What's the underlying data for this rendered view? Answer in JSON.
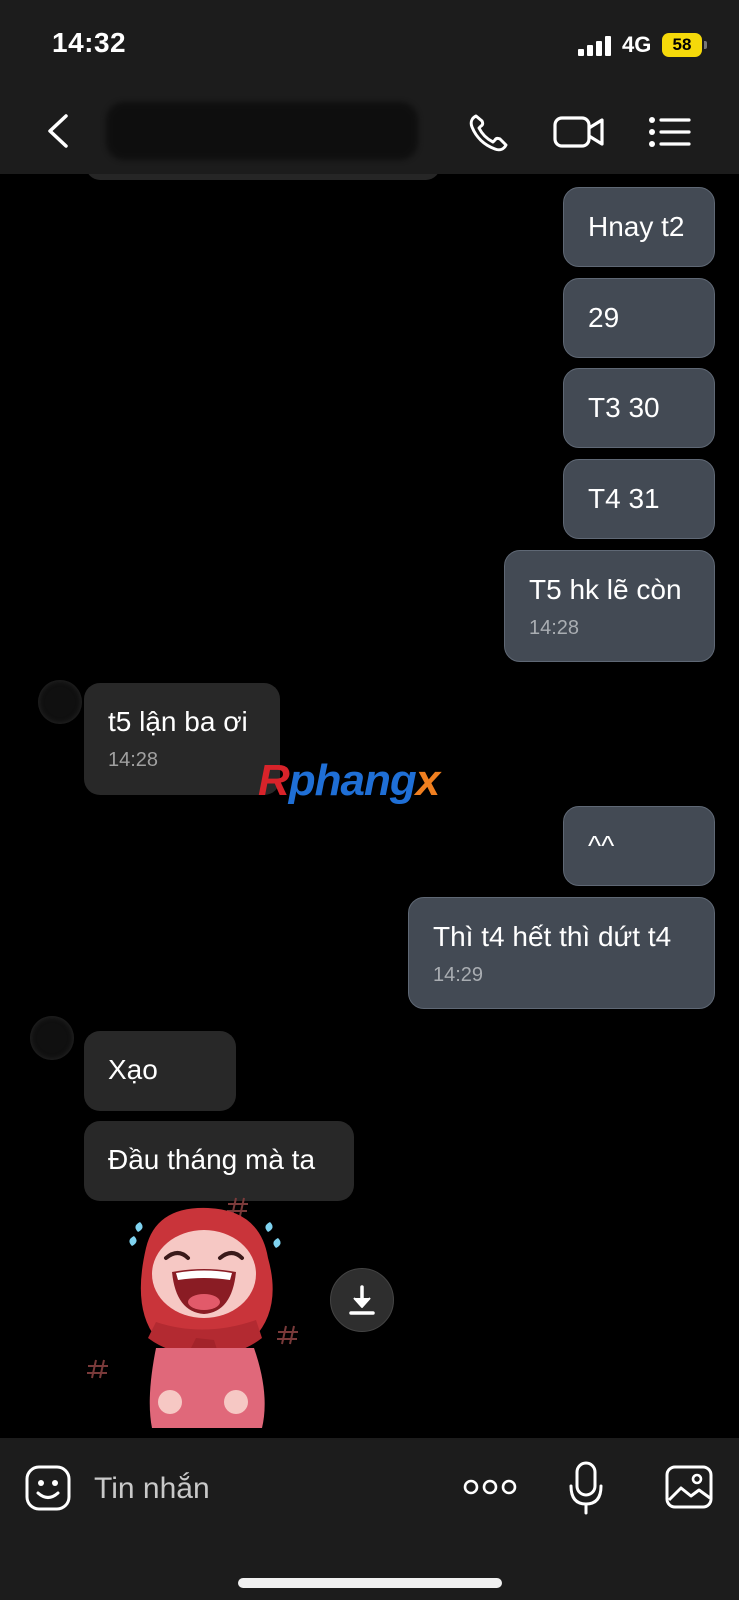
{
  "status_bar": {
    "time": "14:32",
    "network": "4G",
    "battery": "58"
  },
  "header": {
    "contact_name": ""
  },
  "messages": [
    {
      "text": "Hnay t2"
    },
    {
      "text": "29"
    },
    {
      "text": "T3 30"
    },
    {
      "text": "T4 31"
    },
    {
      "text": "T5 hk lẽ còn",
      "time": "14:28"
    },
    {
      "text": "t5 lận ba ơi",
      "time": "14:28"
    },
    {
      "text": "^^"
    },
    {
      "text": "Thì t4 hết thì dứt t4",
      "time": "14:29"
    },
    {
      "text": "Xạo"
    },
    {
      "text": "Đầu tháng mà ta"
    }
  ],
  "watermark": {
    "part1": "R",
    "part2": "phang",
    "part3": "x"
  },
  "input": {
    "placeholder": "Tin nhắn"
  },
  "colors": {
    "outgoing_bubble": "#434a54",
    "incoming_bubble": "#282828",
    "bar_bg": "#1c1c1c",
    "battery": "#f5d90a"
  }
}
